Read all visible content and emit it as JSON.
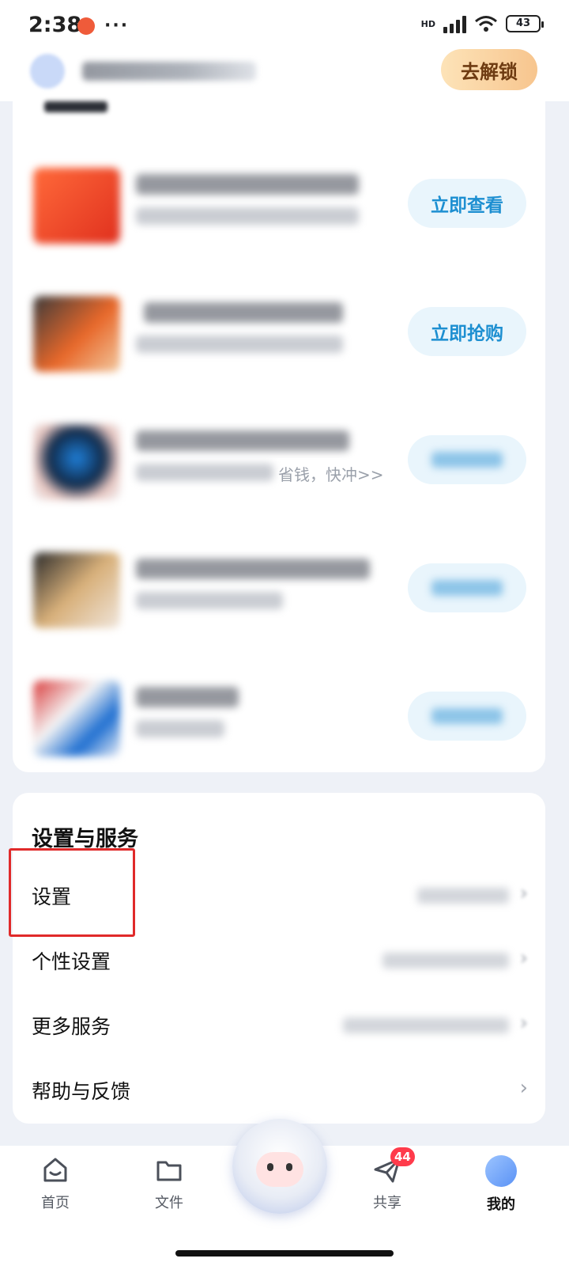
{
  "status_bar": {
    "time": "2:38",
    "battery": "43",
    "network": "HD"
  },
  "header": {
    "unlock_button": "去解锁"
  },
  "promos": {
    "items": [
      {
        "button": "立即查看"
      },
      {
        "button": "立即抢购"
      },
      {
        "visible_text": "省钱，快冲>>"
      }
    ]
  },
  "settings": {
    "title": "设置与服务",
    "rows": [
      {
        "label": "设置"
      },
      {
        "label": "个性设置"
      },
      {
        "label": "更多服务"
      },
      {
        "label": "帮助与反馈",
        "arrow": "›"
      }
    ]
  },
  "nav": {
    "items": [
      {
        "label": "首页"
      },
      {
        "label": "文件"
      },
      {
        "label": "共享",
        "badge": "44"
      },
      {
        "label": "我的"
      }
    ]
  },
  "colors": {
    "accent": "#1d8fd1",
    "highlight": "#e02a2a",
    "unlock_text": "#6e3b11",
    "badge": "#ff3b4b"
  }
}
